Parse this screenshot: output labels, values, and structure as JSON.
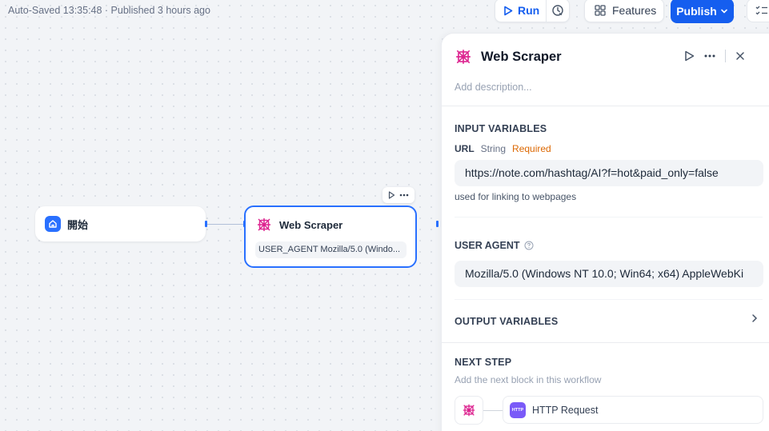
{
  "header": {
    "status_text": "Auto-Saved 13:35:48 · Published 3 hours ago",
    "run_label": "Run",
    "features_label": "Features",
    "publish_label": "Publish"
  },
  "canvas": {
    "start_node": {
      "label": "開始"
    },
    "scraper_node": {
      "title": "Web Scraper",
      "variable_preview": "USER_AGENT Mozilla/5.0 (Windo..."
    }
  },
  "panel": {
    "title": "Web Scraper",
    "description_placeholder": "Add description...",
    "input_section_title": "INPUT VARIABLES",
    "url_variable": {
      "name": "URL",
      "type": "String",
      "required": "Required",
      "value": "https://note.com/hashtag/AI?f=hot&paid_only=false",
      "hint": "used for linking to webpages"
    },
    "user_agent": {
      "title": "USER AGENT",
      "value": "Mozilla/5.0 (Windows NT 10.0; Win64; x64) AppleWebKi"
    },
    "output_section_title": "OUTPUT VARIABLES",
    "next_step": {
      "title": "NEXT STEP",
      "subtitle": "Add the next block in this workflow",
      "next_block_label": "HTTP Request",
      "next_block_icon_text": "HTTP"
    }
  },
  "colors": {
    "accent": "#155eef",
    "node_border": "#2970ff",
    "scraper_icon": "#dd2590",
    "required": "#dc6803",
    "http_icon": "#7a5af8"
  }
}
